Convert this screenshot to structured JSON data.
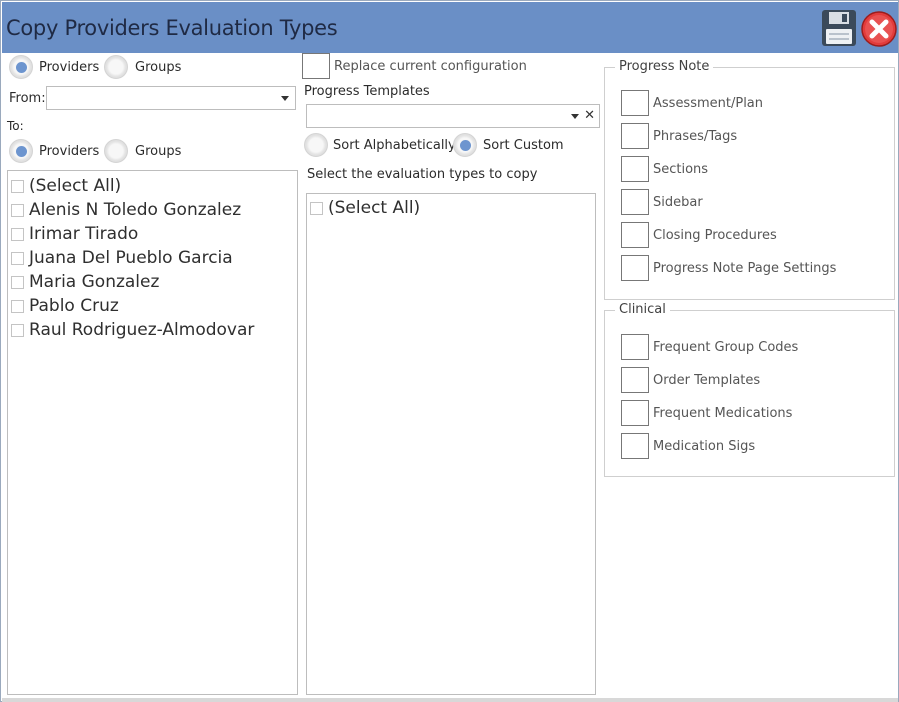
{
  "window": {
    "title": "Copy Providers Evaluation Types"
  },
  "toolbar": {
    "save_icon": "floppy-disk-icon",
    "close_icon": "red-x-circle-icon"
  },
  "source": {
    "radio_providers": "Providers",
    "radio_groups": "Groups",
    "selected": "Providers",
    "from_label": "From:",
    "from_value": ""
  },
  "target": {
    "to_label": "To:",
    "radio_providers": "Providers",
    "radio_groups": "Groups",
    "selected": "Providers",
    "items": [
      "(Select All)",
      "Alenis N Toledo Gonzalez",
      "Irimar Tirado",
      "Juana Del Pueblo Garcia",
      "Maria Gonzalez",
      "Pablo Cruz",
      "Raul Rodriguez-Almodovar"
    ]
  },
  "middle": {
    "replace_label": "Replace current configuration",
    "templates_label": "Progress Templates",
    "templates_value": "",
    "sort_alpha": "Sort Alphabetically",
    "sort_custom": "Sort Custom",
    "sort_selected": "Sort Custom",
    "eval_label": "Select the evaluation types to copy",
    "eval_items": [
      "(Select All)"
    ]
  },
  "progress_note": {
    "title": "Progress Note",
    "options": [
      "Assessment/Plan",
      "Phrases/Tags",
      "Sections",
      "Sidebar",
      "Closing Procedures",
      "Progress Note Page Settings"
    ]
  },
  "clinical": {
    "title": "Clinical",
    "options": [
      "Frequent Group Codes",
      "Order Templates",
      "Frequent Medications",
      "Medication Sigs"
    ]
  },
  "colors": {
    "titlebar": "#6a8fc6",
    "radio_selected": "#6d95cf",
    "close_red": "#e23b3b"
  }
}
